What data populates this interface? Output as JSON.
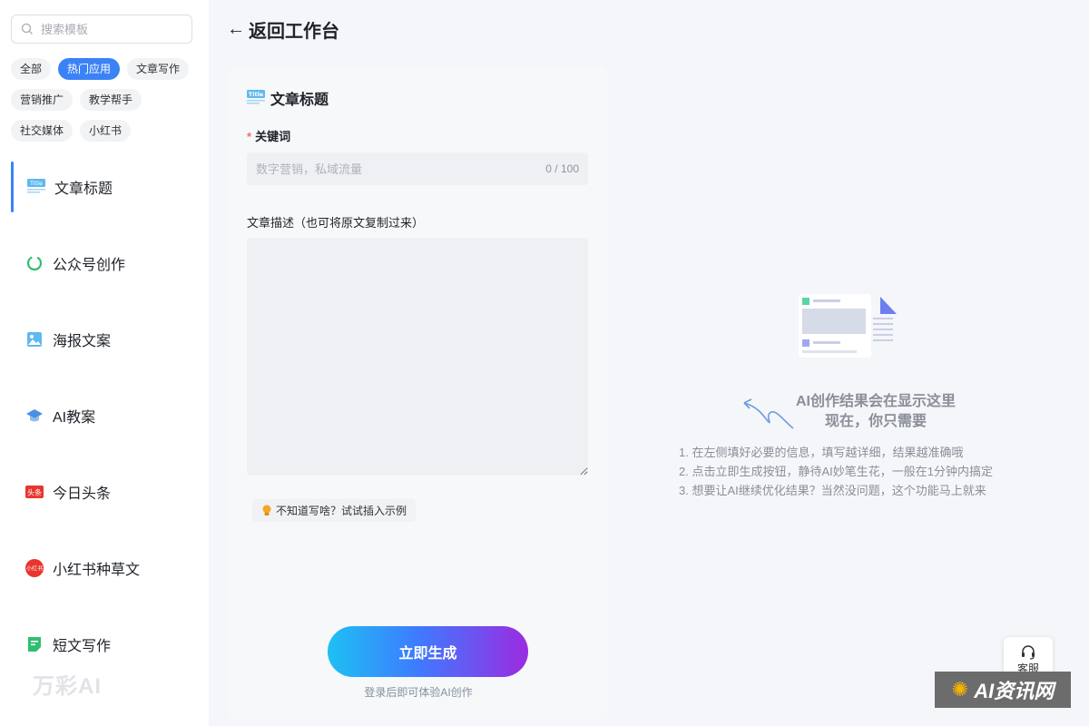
{
  "search": {
    "placeholder": "搜索模板"
  },
  "tags": [
    "全部",
    "热门应用",
    "文章写作",
    "营销推广",
    "教学帮手",
    "社交媒体",
    "小红书"
  ],
  "active_tag_index": 1,
  "nav": [
    {
      "label": "文章标题",
      "icon": "title-icon"
    },
    {
      "label": "公众号创作",
      "icon": "wechat-icon"
    },
    {
      "label": "海报文案",
      "icon": "poster-icon"
    },
    {
      "label": "AI教案",
      "icon": "graduation-cap-icon"
    },
    {
      "label": "今日头条",
      "icon": "toutiao-icon"
    },
    {
      "label": "小红书种草文",
      "icon": "xiaohongshu-icon"
    },
    {
      "label": "短文写作",
      "icon": "note-icon"
    }
  ],
  "active_nav_index": 0,
  "watermark": "万彩AI",
  "header": {
    "back_label": "返回工作台"
  },
  "form": {
    "title": "文章标题",
    "keyword_label": "关键词",
    "keyword_placeholder": "数字营销，私域流量",
    "keyword_counter": "0 / 100",
    "desc_label": "文章描述（也可将原文复制过来）",
    "hint": "不知道写啥？试试插入示例",
    "generate_label": "立即生成",
    "login_tip": "登录后即可体验AI创作"
  },
  "result": {
    "title_line1": "AI创作结果会在显示这里",
    "title_line2": "现在，你只需要",
    "steps": [
      "1. 在左侧填好必要的信息，填写越详细，结果越准确哦",
      "2. 点击立即生成按钮，静待AI妙笔生花，一般在1分钟内搞定",
      "3. 想要让AI继续优化结果？当然没问题，这个功能马上就来"
    ]
  },
  "service": {
    "label": "客服"
  },
  "corner_logo": "AI资讯网",
  "colors": {
    "accent": "#3b82f6",
    "gradient_start": "#1ec0f3",
    "gradient_end": "#9b2be0"
  }
}
